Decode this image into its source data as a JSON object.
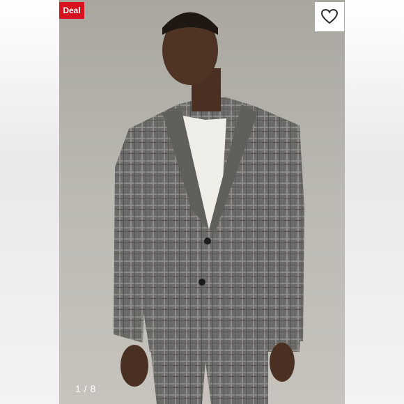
{
  "badge": {
    "label": "Deal",
    "color": "#d8111f"
  },
  "like": {
    "icon": "heart-outline-icon"
  },
  "carousel": {
    "counter": "1 / 8"
  },
  "photo": {
    "icon": "product-photo-suit"
  }
}
